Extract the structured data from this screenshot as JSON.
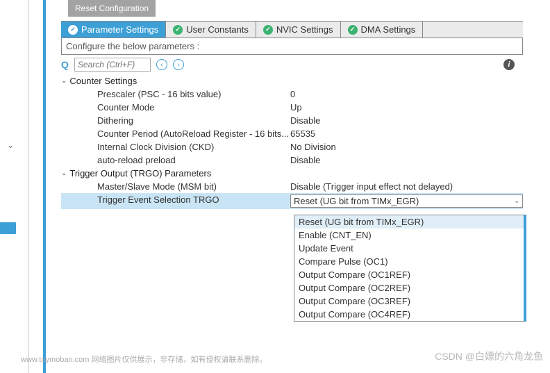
{
  "resetBtn": "Reset Configuration",
  "tabs": [
    {
      "label": "Parameter Settings",
      "active": true
    },
    {
      "label": "User Constants",
      "active": false
    },
    {
      "label": "NVIC Settings",
      "active": false
    },
    {
      "label": "DMA Settings",
      "active": false
    }
  ],
  "instruction": "Configure the below parameters :",
  "searchPlaceholder": "Search (Ctrl+F)",
  "sections": {
    "counter": {
      "title": "Counter Settings",
      "rows": [
        {
          "label": "Prescaler (PSC - 16 bits value)",
          "value": "0"
        },
        {
          "label": "Counter Mode",
          "value": "Up"
        },
        {
          "label": "Dithering",
          "value": "Disable"
        },
        {
          "label": "Counter Period (AutoReload Register - 16 bits...",
          "value": "65535"
        },
        {
          "label": "Internal Clock Division (CKD)",
          "value": "No Division"
        },
        {
          "label": "auto-reload preload",
          "value": "Disable"
        }
      ]
    },
    "trigger": {
      "title": "Trigger Output (TRGO) Parameters",
      "rows": [
        {
          "label": "Master/Slave Mode (MSM bit)",
          "value": "Disable (Trigger input effect not delayed)"
        },
        {
          "label": "Trigger Event Selection TRGO",
          "value": "Reset (UG bit from TIMx_EGR)"
        }
      ]
    }
  },
  "dropdownOptions": [
    "Reset (UG bit from TIMx_EGR)",
    "Enable (CNT_EN)",
    "Update Event",
    "Compare Pulse (OC1)",
    "Output Compare (OC1REF)",
    "Output Compare (OC2REF)",
    "Output Compare (OC3REF)",
    "Output Compare (OC4REF)"
  ],
  "watermarkBottom": "www.toymoban.com  网络图片仅供展示，非存储，如有侵权请联系删除。",
  "watermarkRight": "CSDN @白嫖的六角龙鱼"
}
